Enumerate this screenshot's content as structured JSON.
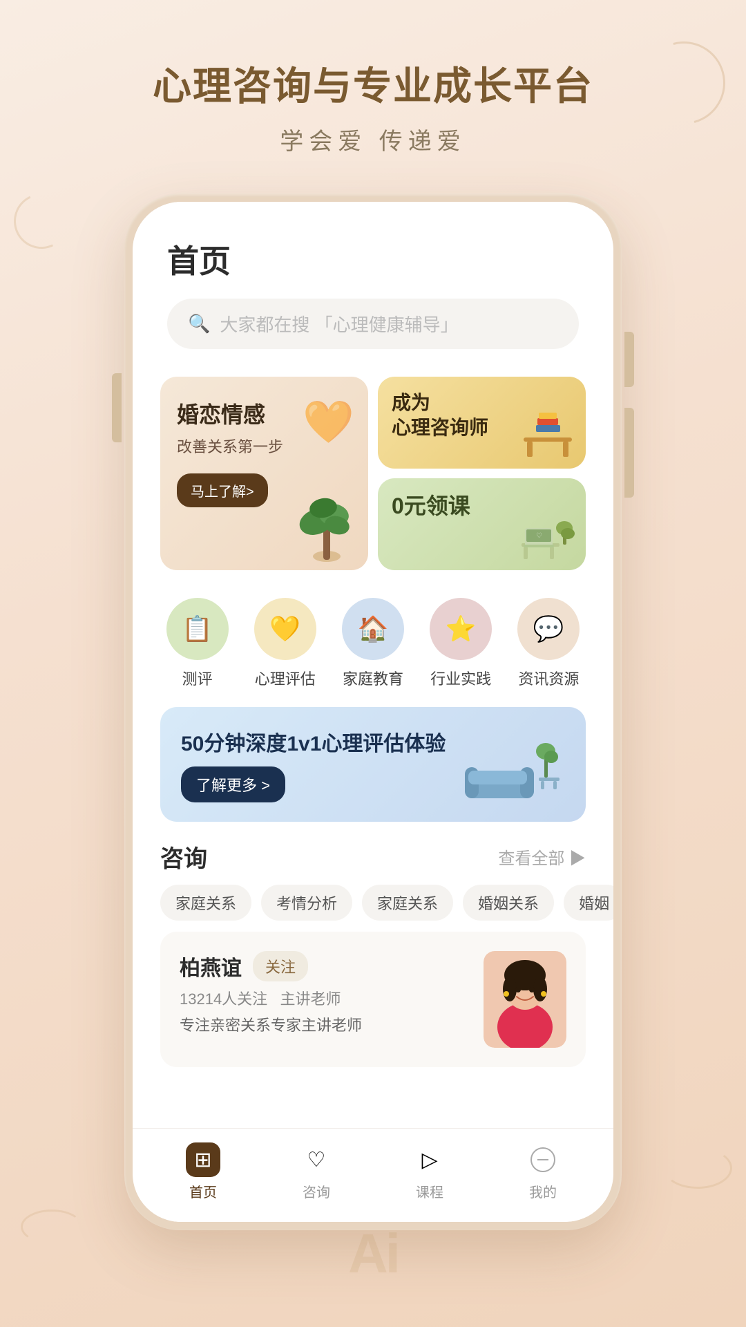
{
  "app": {
    "title": "心理咨询与专业成长平台",
    "subtitle": "学会爱  传递爱",
    "page_title": "首页",
    "search_placeholder": "大家都在搜 「心理健康辅导」"
  },
  "banners": {
    "left": {
      "title": "婚恋情感",
      "subtitle": "改善关系第一步",
      "btn_label": "马上了解>"
    },
    "top_right": {
      "line1": "成为",
      "line2": "心理咨询师"
    },
    "bottom_right": {
      "title": "0元领课"
    }
  },
  "icons": [
    {
      "id": "pingce",
      "label": "测评",
      "emoji": "📝",
      "bg": "#d8e8c0"
    },
    {
      "id": "xinli",
      "label": "心理评估",
      "emoji": "💛",
      "bg": "#f5e8c0"
    },
    {
      "id": "jiating",
      "label": "家庭教育",
      "emoji": "🏠",
      "bg": "#d0dff0"
    },
    {
      "id": "hangye",
      "label": "行业实践",
      "emoji": "⭐",
      "bg": "#e8d0d0"
    },
    {
      "id": "zixun",
      "label": "资讯资源",
      "emoji": "💬",
      "bg": "#f0e0d0"
    }
  ],
  "promo": {
    "title": "50分钟深度1v1心理评估体验",
    "btn_label": "了解更多 >"
  },
  "consult": {
    "section_title": "咨询",
    "see_all": "查看全部 ▶",
    "tags": [
      "家庭关系",
      "考情分析",
      "家庭关系",
      "婚姻关系",
      "婚姻"
    ],
    "consultant": {
      "name": "柏燕谊",
      "follow_label": "关注",
      "followers": "13214人关注",
      "role": "主讲老师",
      "desc": "专注亲密关系专家主讲老师"
    }
  },
  "nav": [
    {
      "id": "home",
      "label": "首页",
      "active": true,
      "icon": "⊞"
    },
    {
      "id": "consult",
      "label": "咨询",
      "active": false,
      "icon": "♡"
    },
    {
      "id": "course",
      "label": "课程",
      "active": false,
      "icon": "▷"
    },
    {
      "id": "mine",
      "label": "我的",
      "active": false,
      "icon": "−"
    }
  ],
  "ai_badge": "Ai"
}
